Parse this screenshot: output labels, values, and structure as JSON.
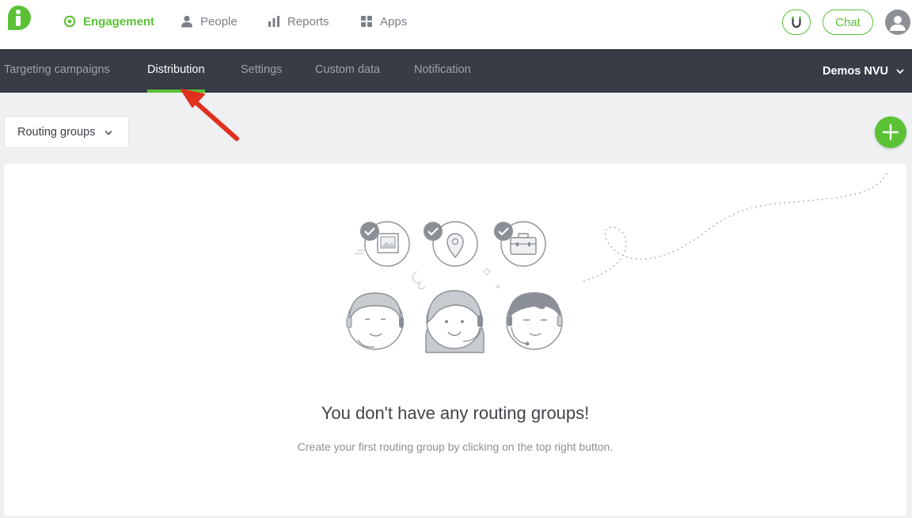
{
  "topnav": {
    "items": [
      {
        "label": "Engagement",
        "icon": "target-icon"
      },
      {
        "label": "People",
        "icon": "person-icon"
      },
      {
        "label": "Reports",
        "icon": "bar-chart-icon"
      },
      {
        "label": "Apps",
        "icon": "grid-icon"
      }
    ],
    "active_index": 0,
    "chat_label": "Chat"
  },
  "subnav": {
    "tabs": [
      {
        "label": "Targeting campaigns"
      },
      {
        "label": "Distribution"
      },
      {
        "label": "Settings"
      },
      {
        "label": "Custom data"
      },
      {
        "label": "Notification"
      }
    ],
    "active_index": 1,
    "account_label": "Demos NVU"
  },
  "toolbar": {
    "select_label": "Routing groups"
  },
  "empty_state": {
    "title": "You don't have any routing groups!",
    "subtitle": "Create your first routing group by clicking on the top right button."
  },
  "colors": {
    "brand_green": "#5bc236",
    "subnav_bg": "#373c47",
    "annotation_arrow": "#e0301e"
  }
}
